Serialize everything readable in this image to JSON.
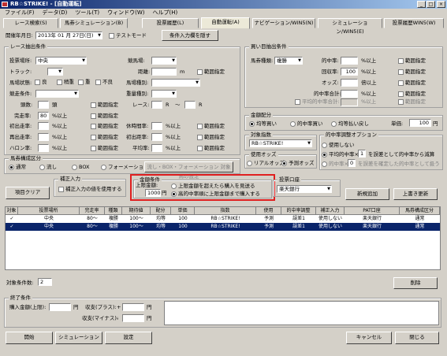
{
  "window": {
    "title": "RB☆STRIKE! - [自動運転]",
    "min": "_",
    "max": "□",
    "close": "×"
  },
  "menu": [
    "ファイル(F)",
    "データ(D)",
    "ツール(T)",
    "ウィンドウ(W)",
    "ヘルプ(H)"
  ],
  "tabs": [
    "レース検索(S)",
    "馬券シミュレーション(B)",
    "投票履歴(L)",
    "自動運転(A)",
    "ナビゲーション/WIN5(N)",
    "シミュレーション/WIN5(E)",
    "投票履歴WIN5(W)"
  ],
  "header": {
    "date_label": "開催年月日:",
    "date_value": "2013年 01 月 27日(日)",
    "test_mode": "テストモード",
    "conditions_btn": "条件入力欄を隠す"
  },
  "race": {
    "title": "レース抽出条件",
    "venue_l": "投票場所:",
    "venue_v": "中央",
    "track_l": "トラック:",
    "state_l": "馬場状態:",
    "good": "良",
    "slight": "稍重",
    "heavy": "重",
    "bad": "不良",
    "cond_l": "競走条件:",
    "age_l": "頭数:",
    "age_unit": "頭",
    "pace_l": "完走率:",
    "pace_v": "80",
    "pace_unit": "%以上",
    "first_l": "初出走率:",
    "first_unit": "%以上",
    "kaisai_l": "再出走率:",
    "kaisai_unit": "%以上",
    "haron_l": "ハロン率:",
    "haron_unit": "%以上",
    "cls_l": "競馬場:",
    "dist_l": "距離:",
    "dist_unit": "m",
    "range": "範囲指定",
    "kind_l": "馬場種別:",
    "wt_l": "重量種別:",
    "race_l": "レース:",
    "R": "R",
    "rest_l": "休時間率:",
    "chg_l": "初出距率:",
    "rate_l": "平均率:",
    "pct": "%以上"
  },
  "buy": {
    "title": "買い目抽出条件",
    "type_l": "馬券種類:",
    "type_v": "複勝",
    "hit_l": "的中率:",
    "hit_unit": "%以上",
    "ret_l": "回収率:",
    "ret_v": "100",
    "ret_unit": "%以上",
    "odds_l": "オッズ:",
    "odds_unit": "倍以上",
    "tot_l": "的中率合計:",
    "tot_unit": "%以上",
    "avg_l": "平均的中率合計:",
    "avg_unit": "%以上",
    "range": "範囲指定",
    "range2": "範囲指定"
  },
  "money": {
    "title": "金額配分",
    "o1": "均等買い",
    "o2": "的中率買い",
    "o3": "均等払い戻し",
    "unit_l": "単価:",
    "unit_v": "100",
    "unit_suffix": "円"
  },
  "idx": {
    "title": "対象指数",
    "value": "RB☆STRIKE!"
  },
  "oddsuse": {
    "title": "使用オッズ",
    "o1": "リアルオッズ",
    "o2": "予測オッズ"
  },
  "adj": {
    "title": "的中率調整オプション",
    "o1": "使用しない",
    "o2": "平均的中率×",
    "v2": "1",
    "t2": "を誤差として的中率から減算",
    "o3": "的中率×",
    "v3": "0",
    "t3": "を誤差を確定した的中率として扱う"
  },
  "bettype": {
    "title": "馬券構成区分",
    "o1": "通常",
    "o2": "流し",
    "o3": "BOX",
    "o4": "フォーメーション",
    "btn": "流し・BOX・フォーメーション 対象馬の設定"
  },
  "clear_btn": "項目クリア",
  "fix": {
    "title": "補正入力",
    "cb": "補正入力の値を使用する"
  },
  "amount": {
    "title": "金額条件",
    "limit_l": "上限金額:",
    "limit_v": "1000",
    "limit_unit": "円",
    "o1": "上限金額を超えたら購入を見送る",
    "o2": "高的中率順に上限金額まで購入する"
  },
  "bank": {
    "title": "投票口座",
    "value": "楽天銀行",
    "add": "新規追加",
    "save": "上書き更新"
  },
  "table": {
    "headers": [
      "対象",
      "投票場所",
      "完走率",
      "種類",
      "期待値",
      "配分",
      "単価",
      "指数",
      "使用",
      "的中率調整",
      "補正入力",
      "PAT口座",
      "馬券構成区分"
    ],
    "rows": [
      [
        "✓",
        "中央",
        "80〜",
        "複勝",
        "100〜",
        "均等",
        "100",
        "RB☆STRIKE!",
        "予測",
        "誤差1",
        "使用しない",
        "楽天銀行",
        "通常"
      ],
      [
        "✓",
        "中央",
        "80〜",
        "複勝",
        "100〜",
        "均等",
        "100",
        "RB☆STRIKE!",
        "予測",
        "誤差1",
        "使用しない",
        "楽天銀行",
        "通常"
      ]
    ]
  },
  "count": {
    "label": "対象条件数:",
    "value": "2",
    "del": "削除"
  },
  "end": {
    "title": "終了条件",
    "buy_l": "購入金額(上限):",
    "yen": "円",
    "plus_l": "収支(プラス):",
    "minus_l": "収支(マイナス):",
    "plus_sign": "+",
    "minus_sign": "-"
  },
  "footer": {
    "start": "開始",
    "sim": "シミュレーション",
    "set": "設定",
    "cancel": "キャンセル",
    "close": "閉じる"
  }
}
